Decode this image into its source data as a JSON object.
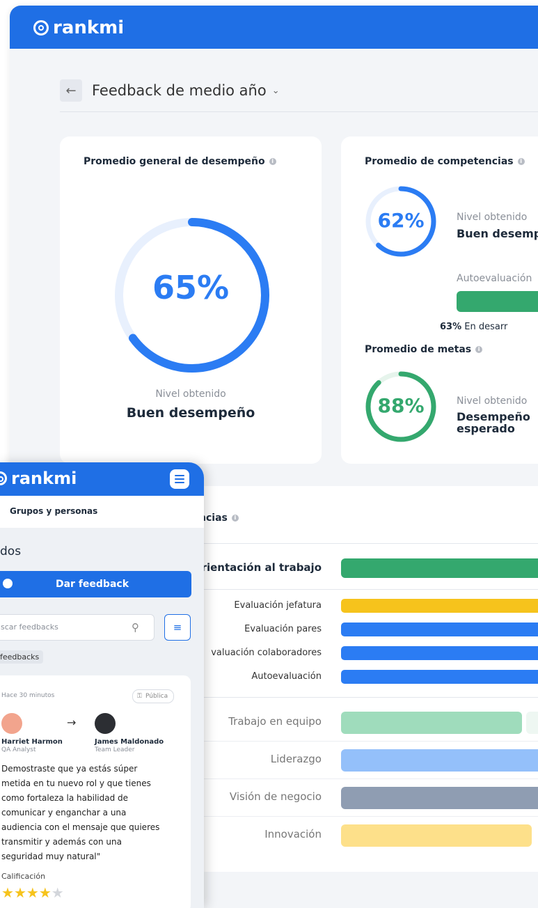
{
  "brand": "rankmi",
  "breadcrumb": {
    "title": "Feedback de medio año"
  },
  "colors": {
    "blue": "#1f6fe5",
    "ring_blue": "#2b7cf3",
    "green": "#34a86e",
    "yellow": "#f6c31c"
  },
  "general": {
    "title": "Promedio general de desempeño",
    "percent": "65%",
    "value": 0.65,
    "level_label": "Nivel obtenido",
    "level": "Buen desempeño"
  },
  "competencias": {
    "title": "Promedio de competencias",
    "percent": "62%",
    "value": 0.62,
    "level_label": "Nivel obtenido",
    "level": "Buen desemp",
    "auto_label": "Autoevaluación",
    "auto_value": "63%",
    "auto_text": "En desarr"
  },
  "metas": {
    "title": "Promedio de metas",
    "percent": "88%",
    "value": 0.88,
    "level_label": "Nivel obtenido",
    "level_line1": "Desempeño",
    "level_line2": "esperado"
  },
  "detail": {
    "header": "ncias",
    "rows": [
      {
        "label": "Orientación al trabajo"
      },
      {
        "label": "Evaluación jefatura"
      },
      {
        "label": "Evaluación pares"
      },
      {
        "label": "valuación colaboradores"
      },
      {
        "label": "Autoevaluación"
      },
      {
        "label": "Trabajo en equipo"
      },
      {
        "label": "Liderazgo"
      },
      {
        "label": "Visión de negocio"
      },
      {
        "label": "Innovación"
      }
    ]
  },
  "mobile": {
    "brand": "rankmi",
    "tab": "Grupos y personas",
    "section": "dos",
    "cta": "Dar feedback",
    "search_placeholder": "scar feedbacks",
    "chip": "feedbacks",
    "feed": {
      "time": "Hace 30 minutos",
      "visibility": "Pública",
      "from_name": "Harriet Harmon",
      "from_role": "QA Analyst",
      "to_name": "James Maldonado",
      "to_role": "Team Leader",
      "message_lines": [
        "Demostraste que ya estás súper",
        "metida en tu nuevo rol y que tienes",
        "como fortaleza la habilidad de",
        "comunicar y enganchar a una",
        "audiencia con el mensaje que quieres",
        "transmitir y además con una",
        "seguridad muy natural\""
      ],
      "rating_label": "Calificación",
      "rating": 4,
      "rating_max": 5
    }
  }
}
